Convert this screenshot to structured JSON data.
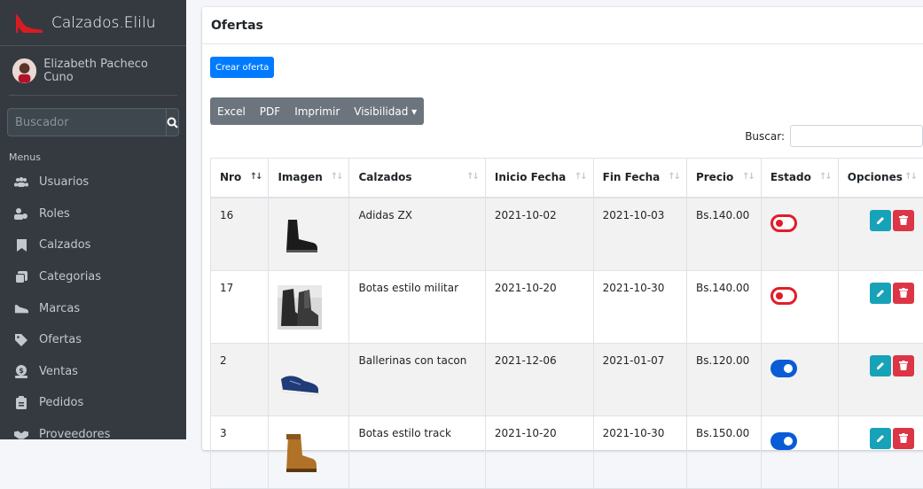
{
  "brand": {
    "name": "Calzados.Elilu"
  },
  "user": {
    "name": "Elizabeth Pacheco Cuno"
  },
  "sidebar": {
    "search_placeholder": "Buscador",
    "menu_header": "Menus",
    "items": [
      {
        "label": "Usuarios",
        "icon": "users-icon"
      },
      {
        "label": "Roles",
        "icon": "roles-icon"
      },
      {
        "label": "Calzados",
        "icon": "bookmark-icon"
      },
      {
        "label": "Categorias",
        "icon": "category-icon"
      },
      {
        "label": "Marcas",
        "icon": "shoe-icon"
      },
      {
        "label": "Ofertas",
        "icon": "tag-icon"
      },
      {
        "label": "Ventas",
        "icon": "money-icon"
      },
      {
        "label": "Pedidos",
        "icon": "clipboard-icon"
      },
      {
        "label": "Proveedores",
        "icon": "handshake-icon"
      }
    ]
  },
  "page": {
    "title": "Ofertas",
    "create_button": "Crear oferta"
  },
  "toolbar": {
    "excel": "Excel",
    "pdf": "PDF",
    "print": "Imprimir",
    "visibility": "Visibilidad"
  },
  "filter": {
    "label": "Buscar:"
  },
  "table": {
    "headers": [
      "Nro",
      "Imagen",
      "Calzados",
      "Inicio Fecha",
      "Fin Fecha",
      "Precio",
      "Estado",
      "Opciones"
    ],
    "rows": [
      {
        "nro": "16",
        "calzado": "Adidas ZX",
        "inicio": "2021-10-02",
        "fin": "2021-10-03",
        "precio": "Bs.140.00",
        "estado": "off"
      },
      {
        "nro": "17",
        "calzado": "Botas estilo militar",
        "inicio": "2021-10-20",
        "fin": "2021-10-30",
        "precio": "Bs.140.00",
        "estado": "off"
      },
      {
        "nro": "2",
        "calzado": "Ballerinas con tacon",
        "inicio": "2021-12-06",
        "fin": "2021-01-07",
        "precio": "Bs.120.00",
        "estado": "on"
      },
      {
        "nro": "3",
        "calzado": "Botas estilo track",
        "inicio": "2021-10-20",
        "fin": "2021-10-30",
        "precio": "Bs.150.00",
        "estado": "on"
      }
    ]
  },
  "colors": {
    "sidebar": "#343a40",
    "primary": "#007bff",
    "info": "#17a2b8",
    "danger": "#dc3545",
    "toggle_on": "#0a5cd6"
  }
}
